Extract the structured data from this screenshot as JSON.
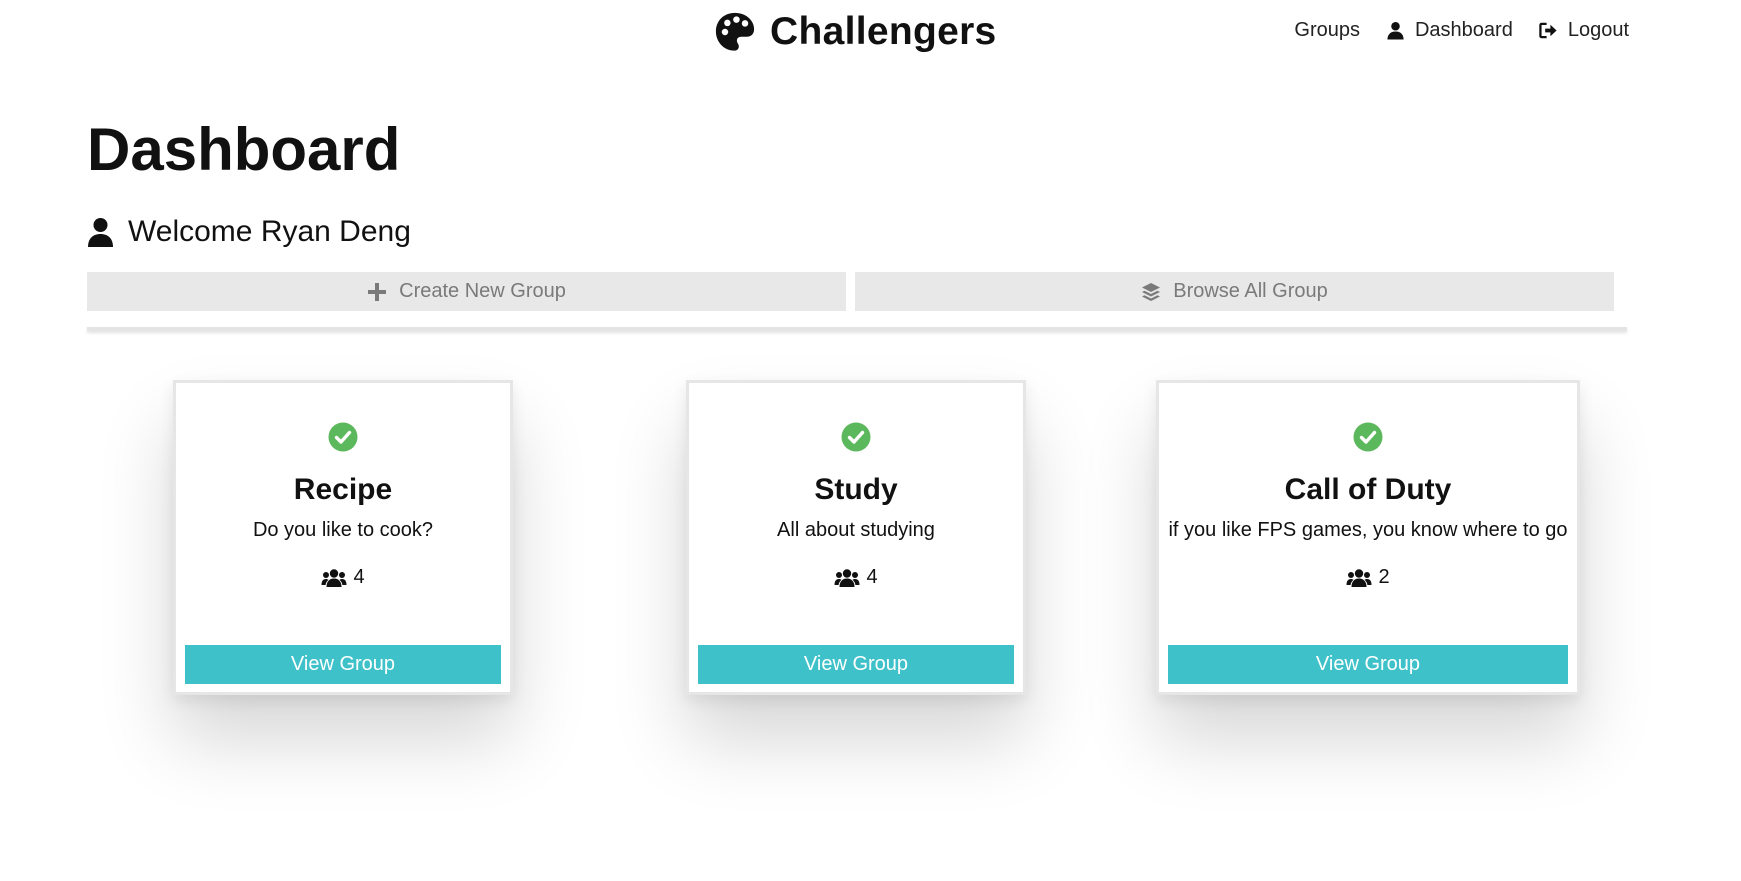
{
  "brand": {
    "name": "Challengers",
    "icon": "palette-icon"
  },
  "nav": {
    "groups_label": "Groups",
    "dashboard_label": "Dashboard",
    "dashboard_icon": "user-icon",
    "logout_label": "Logout",
    "logout_icon": "sign-out-icon"
  },
  "header": {
    "title": "Dashboard",
    "welcome": "Welcome Ryan Deng",
    "welcome_icon": "user-icon"
  },
  "actions": {
    "create_label": "Create New Group",
    "create_icon": "plus-icon",
    "browse_label": "Browse All Group",
    "browse_icon": "layers-icon"
  },
  "groups": [
    {
      "title": "Recipe",
      "description": "Do you like to cook?",
      "members": "4",
      "button": "View Group",
      "status_icon": "check-circle-icon"
    },
    {
      "title": "Study",
      "description": "All about studying",
      "members": "4",
      "button": "View Group",
      "status_icon": "check-circle-icon"
    },
    {
      "title": "Call of Duty",
      "description": "if you like FPS games, you know where to go",
      "members": "2",
      "button": "View Group",
      "status_icon": "check-circle-icon"
    }
  ],
  "colors": {
    "accent": "#3ec1c9",
    "success": "#5cb85c",
    "action_bg": "#e8e8e8",
    "action_text": "#7a7a7a"
  }
}
